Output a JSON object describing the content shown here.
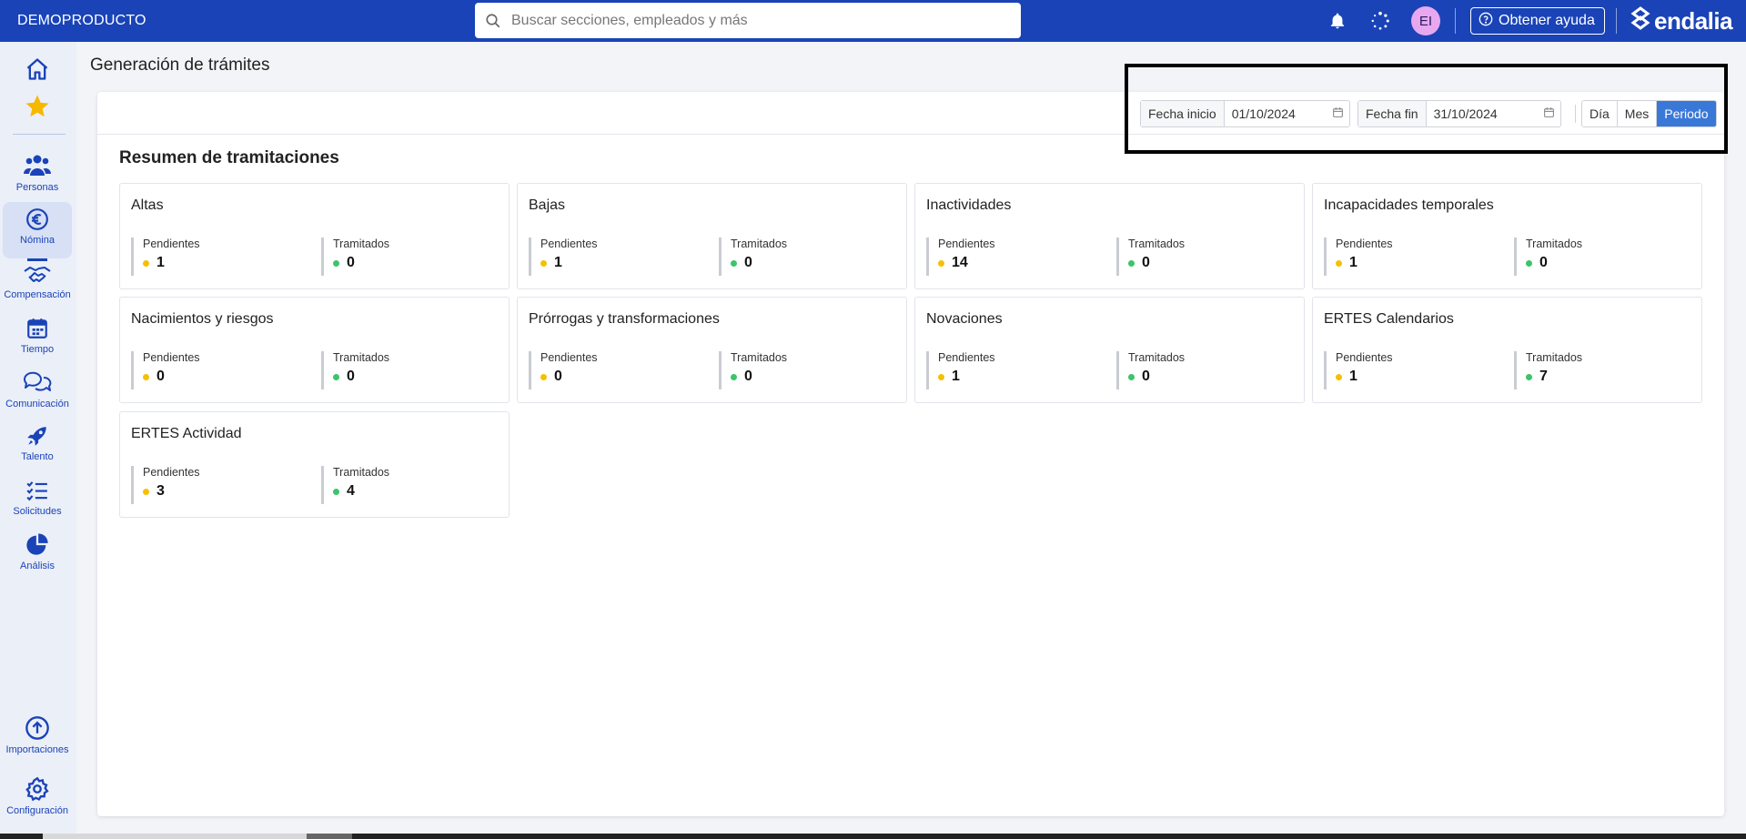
{
  "app": {
    "company": "DEMOPRODUCTO",
    "search_placeholder": "Buscar secciones, empleados y más",
    "avatar_initials": "EI",
    "help_label": "Obtener ayuda",
    "logo_text": "endalia"
  },
  "sidebar": {
    "items": [
      {
        "label": "",
        "icon": "home-icon"
      },
      {
        "label": "",
        "icon": "star-icon"
      },
      {
        "label": "Personas",
        "icon": "people-icon"
      },
      {
        "label": "Nómina",
        "icon": "euro-icon"
      },
      {
        "label": "Compensación",
        "icon": "handshake-icon"
      },
      {
        "label": "Tiempo",
        "icon": "calendar-icon"
      },
      {
        "label": "Comunicación",
        "icon": "chat-icon"
      },
      {
        "label": "Talento",
        "icon": "rocket-icon"
      },
      {
        "label": "Solicitudes",
        "icon": "checklist-icon"
      },
      {
        "label": "Análisis",
        "icon": "pie-chart-icon"
      },
      {
        "label": "Importaciones",
        "icon": "upload-icon"
      },
      {
        "label": "Configuración",
        "icon": "gear-icon"
      }
    ]
  },
  "page": {
    "title": "Generación de trámites",
    "section_title": "Resumen de tramitaciones"
  },
  "filters": {
    "start_label": "Fecha inicio",
    "start_value": "01/10/2024",
    "end_label": "Fecha fin",
    "end_value": "31/10/2024",
    "modes": [
      "Día",
      "Mes",
      "Periodo"
    ],
    "active_mode": "Periodo"
  },
  "summary": {
    "pending_label": "Pendientes",
    "done_label": "Tramitados",
    "pending_color": "#f5c000",
    "done_color": "#3cc46a",
    "tiles": [
      {
        "title": "Altas",
        "pending": "1",
        "done": "0"
      },
      {
        "title": "Bajas",
        "pending": "1",
        "done": "0"
      },
      {
        "title": "Inactividades",
        "pending": "14",
        "done": "0"
      },
      {
        "title": "Incapacidades temporales",
        "pending": "1",
        "done": "0"
      },
      {
        "title": "Nacimientos y riesgos",
        "pending": "0",
        "done": "0"
      },
      {
        "title": "Prórrogas y transformaciones",
        "pending": "0",
        "done": "0"
      },
      {
        "title": "Novaciones",
        "pending": "1",
        "done": "0"
      },
      {
        "title": "ERTES Calendarios",
        "pending": "1",
        "done": "7"
      },
      {
        "title": "ERTES Actividad",
        "pending": "3",
        "done": "4"
      }
    ]
  },
  "colors": {
    "brand": "#1a43b8",
    "active_toggle": "#3a78d8"
  }
}
